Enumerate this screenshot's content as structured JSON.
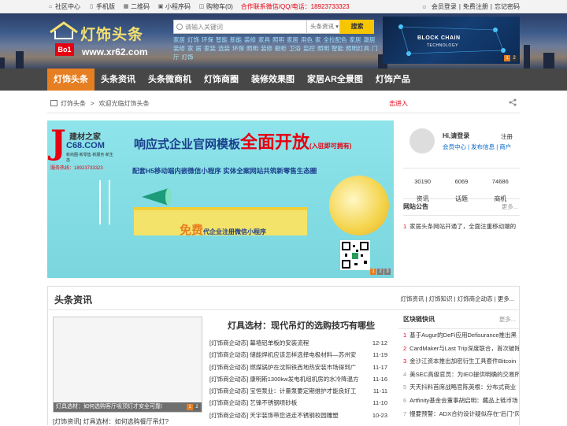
{
  "topbar": {
    "community": "社区中心",
    "mobile": "手机版",
    "qrcode": "二维码",
    "miniapp": "小程序码",
    "cart": "购物车(0)",
    "hotline": "合作联系微信/QQ/电话：18923733323",
    "login": "会员登录",
    "register": "免费注册",
    "forgot": "忘记密码",
    "sep": "|"
  },
  "logo": {
    "brand": "灯饰头条",
    "badge": "Bo1",
    "url": "www.xr62.com"
  },
  "search": {
    "placeholder": "请输入关键词",
    "scope": "头条资讯",
    "button": "搜索",
    "keywords": [
      "家居",
      "灯饰",
      "环保",
      "智能",
      "新能",
      "装修",
      "家具",
      "照明",
      "家居",
      "用色",
      "家",
      "全拉配色",
      "家居",
      "潮居装修",
      "家",
      "居",
      "家装",
      "选装",
      "环保",
      "照明",
      "装修",
      "橱柜",
      "卫浴",
      "监控",
      "照明",
      "智能",
      "照明灯具",
      "门厅",
      "灯饰"
    ]
  },
  "blockad": {
    "text": "BLOCK CHAIN",
    "sub": "TECHNOLOGY",
    "pages": [
      "1",
      "2"
    ]
  },
  "nav": {
    "items": [
      "灯饰头条",
      "头条资讯",
      "头条微商机",
      "灯饰商圈",
      "装修效果图",
      "家居AR全景图",
      "灯饰产品"
    ]
  },
  "crumb": {
    "home": "灯饰头条",
    "sep": ">",
    "current": "欢迎光临灯饰头条",
    "red": "击进入"
  },
  "banner": {
    "logo_letter": "J",
    "logo_cn": "建材之家",
    "logo_en": "C68.COM",
    "logo_tag": "新商圈·新零售·新服务·新生态",
    "phone": "服务热线：18923733323",
    "headline_a": "响应式企业官网模板",
    "headline_b": "全面开放",
    "headline_c": "(入驻即可拥有)",
    "sub": "配套H5移动端内嵌微信小程序  实体全案网站共筑新零售生态圈",
    "free_a": "免费",
    "free_b": "代企业注册微信小程序",
    "pages": [
      "1",
      "2",
      "3"
    ]
  },
  "user": {
    "hi": "Hi,请登录",
    "reg": "注册",
    "links": "会员中心 | 发布信息 | 商户",
    "stats": [
      {
        "v": "30190",
        "k": "资讯"
      },
      {
        "v": "6069",
        "k": "话题"
      },
      {
        "v": "74686",
        "k": "商机"
      }
    ],
    "notice_title": "网站公告",
    "more": "更多...",
    "notice_num": "1",
    "notice_text": "家居头条网站开通了，全面注重移动端的"
  },
  "news": {
    "title": "头条资讯",
    "tabs": "灯饰资讯 | 灯饰知识 | 灯饰商企动态 | 更多...",
    "pic_caption": "灯具选材：如何选购客厅吸顶灯才安全可靠!",
    "pic_pages": [
      "1",
      "2"
    ],
    "pic_sub": "[灯饰资讯] 灯具选材：如何选购餐厅吊灯?",
    "headline": "灯具选材：现代吊灯的选购技巧有哪些",
    "list": [
      {
        "t": "[灯饰商企动态] 幕墙铝单板的安装流程",
        "d": "12-12"
      },
      {
        "t": "[灯饰商企动态] 储能焊机应该怎样选择电极材料—苏州安",
        "d": "11-19"
      },
      {
        "t": "[灯饰商企动态] 燃煤锅炉在沈阳铁西地热安装市场得到广",
        "d": "11-17"
      },
      {
        "t": "[灯饰商企动态] 康明斯1300kw发电机组机房的水冷降温方",
        "d": "11-16"
      },
      {
        "t": "[灯饰商企动态] 宝恒泵业：计量泵要定期维护才能良好工",
        "d": "11-11"
      },
      {
        "t": "[灯饰商企动态] 艺锋不锈钢喷砂板",
        "d": "11-10"
      },
      {
        "t": "[灯饰商企动态] 天宇装饰带您进走不锈钢校园雕塑",
        "d": "10-23"
      }
    ],
    "fast_title": "区块链快讯",
    "fast_more": "更多...",
    "fast": [
      {
        "n": "1",
        "t": "基于Augur的DeFi应用Defisurance推出黑"
      },
      {
        "n": "2",
        "t": "CardMaker与Last Trip深度联合，首次破除"
      },
      {
        "n": "3",
        "t": "金沙江资本推出加密衍生工具套件Bitcoin"
      },
      {
        "n": "4",
        "t": "美SEC高级官员：为IEO提供明确的交易所"
      },
      {
        "n": "5",
        "t": "天天抖料首席战略官陈英根：分布式商业"
      },
      {
        "n": "6",
        "t": "Artfinity基金会董事胡启明：藏品上链币场"
      },
      {
        "n": "7",
        "t": "慢要预警：ADX合约设计疑似存在\"后门\"风"
      }
    ]
  }
}
